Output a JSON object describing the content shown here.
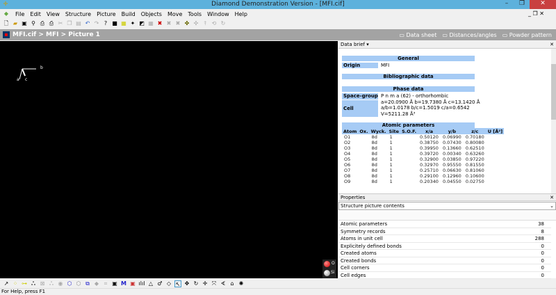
{
  "title": "Diamond Demonstration Version - [MFI.cif]",
  "menu": [
    "File",
    "Edit",
    "View",
    "Structure",
    "Picture",
    "Build",
    "Objects",
    "Move",
    "Tools",
    "Window",
    "Help"
  ],
  "breadcrumb": "MFI.cif > MFI > Picture 1",
  "view_tabs": [
    "Data sheet",
    "Distances/angles",
    "Powder pattern"
  ],
  "axes": {
    "b": "b",
    "a": "a",
    "c": "c"
  },
  "legend": [
    "O",
    "Si"
  ],
  "data_brief": {
    "header": "Data brief",
    "general": "General",
    "origin_label": "Origin",
    "origin": "MFI",
    "biblio": "Bibliographic data",
    "phase": "Phase data",
    "sg_label": "Space-group",
    "sg": "P n m a (62) - orthorhombic",
    "cell_label": "Cell",
    "cell1": "a=20.0900 Å b=19.7380 Å c=13.1420 Å",
    "cell2": "a/b=1.0178 b/c=1.5019 c/a=0.6542",
    "cell3": "V=5211.28 Å³",
    "atomic": "Atomic parameters",
    "columns": [
      "Atom",
      "Ox.",
      "Wyck.",
      "Site",
      "S.O.F.",
      "x/a",
      "y/b",
      "z/c",
      "U [Å²]"
    ],
    "rows": [
      [
        "O1",
        "",
        "8d",
        "1",
        "",
        "0.50120",
        "0.06990",
        "0.70180",
        ""
      ],
      [
        "O2",
        "",
        "8d",
        "1",
        "",
        "0.38750",
        "0.07430",
        "0.80080",
        ""
      ],
      [
        "O3",
        "",
        "8d",
        "1",
        "",
        "0.39950",
        "0.13660",
        "0.62510",
        ""
      ],
      [
        "O4",
        "",
        "8d",
        "1",
        "",
        "0.39720",
        "0.00340",
        "0.63260",
        ""
      ],
      [
        "O5",
        "",
        "8d",
        "1",
        "",
        "0.32900",
        "0.03850",
        "0.97220",
        ""
      ],
      [
        "O6",
        "",
        "8d",
        "1",
        "",
        "0.32970",
        "0.95550",
        "0.81550",
        ""
      ],
      [
        "O7",
        "",
        "8d",
        "1",
        "",
        "0.25710",
        "0.06630",
        "0.81060",
        ""
      ],
      [
        "O8",
        "",
        "8d",
        "1",
        "",
        "0.29100",
        "0.12960",
        "0.10600",
        ""
      ],
      [
        "O9",
        "",
        "8d",
        "1",
        "",
        "0.20340",
        "0.04550",
        "0.02750",
        ""
      ]
    ]
  },
  "properties": {
    "header": "Properties",
    "select": "Structure picture contents",
    "items": [
      [
        "Atomic parameters",
        "38"
      ],
      [
        "Symmetry records",
        "8"
      ],
      [
        "Atoms in unit cell",
        "288"
      ],
      [
        "Explicitely defined bonds",
        "0"
      ],
      [
        "Created atoms",
        "0"
      ],
      [
        "Created bonds",
        "0"
      ],
      [
        "Cell corners",
        "0"
      ],
      [
        "Cell edges",
        "0"
      ]
    ]
  },
  "status": "For Help, press F1"
}
